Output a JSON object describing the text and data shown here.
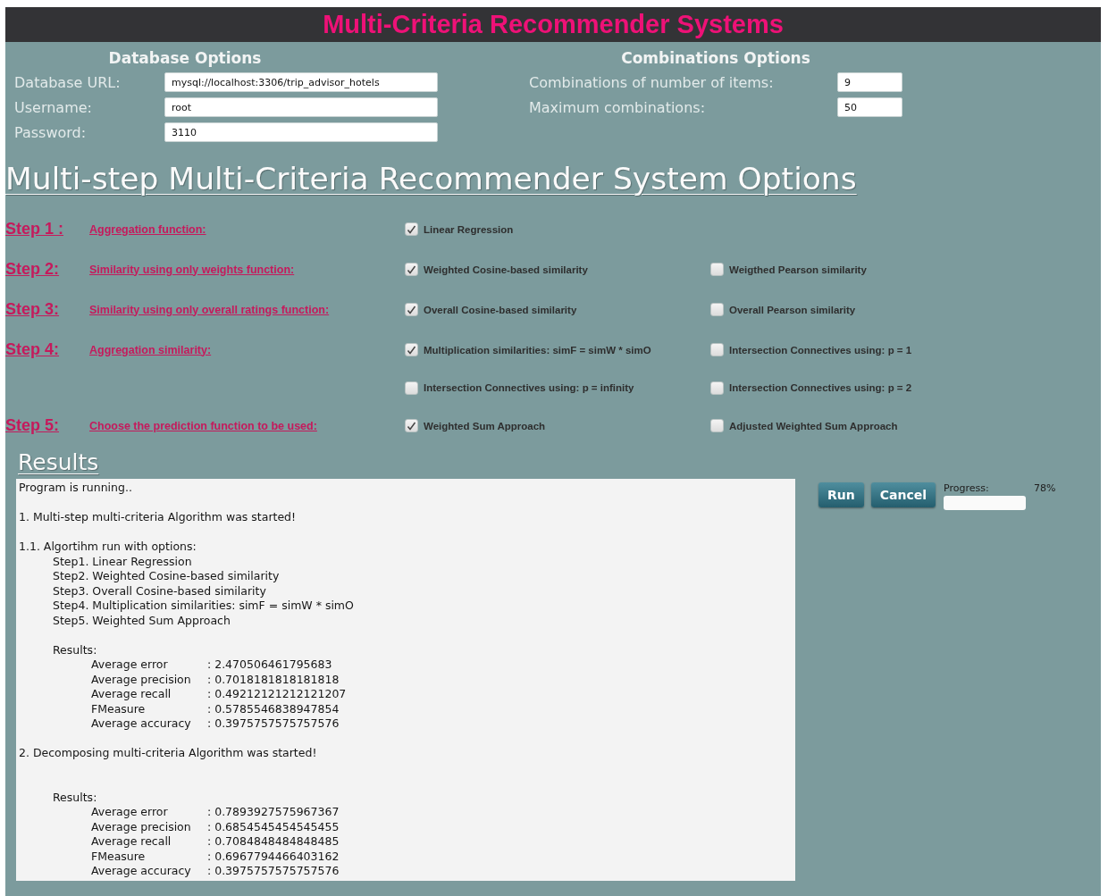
{
  "window": {
    "title": "Multi-Criteria Recommender Systems"
  },
  "database_options": {
    "title": "Database Options",
    "fields": [
      {
        "label": "Database URL:",
        "value": "mysql://localhost:3306/trip_advisor_hotels"
      },
      {
        "label": "Username:",
        "value": "root"
      },
      {
        "label": "Password:",
        "value": "3110"
      }
    ]
  },
  "combinations_options": {
    "title": "Combinations Options",
    "fields": [
      {
        "label": "Combinations of number of items:",
        "value": "9"
      },
      {
        "label": "Maximum combinations:",
        "value": "50"
      }
    ]
  },
  "options_heading": "Multi-step Multi-Criteria Recommender System Options",
  "steps": [
    {
      "step": "Step 1 :",
      "label": "Aggregation function:",
      "option_rows": [
        [
          {
            "label": "Linear Regression",
            "checked": true
          }
        ]
      ]
    },
    {
      "step": "Step 2:",
      "label": "Similarity using only weights function:",
      "option_rows": [
        [
          {
            "label": "Weighted Cosine-based similarity",
            "checked": true
          },
          {
            "label": "Weigthed Pearson similarity",
            "checked": false
          }
        ]
      ]
    },
    {
      "step": "Step 3:",
      "label": "Similarity using only overall ratings function:",
      "option_rows": [
        [
          {
            "label": "Overall Cosine-based similarity",
            "checked": true
          },
          {
            "label": "Overall Pearson similarity",
            "checked": false
          }
        ]
      ]
    },
    {
      "step": "Step 4:",
      "label": "Aggregation similarity:",
      "option_rows": [
        [
          {
            "label": "Multiplication similarities: simF = simW * simO",
            "checked": true
          },
          {
            "label": "Intersection Connectives using: p = 1",
            "checked": false
          }
        ],
        [
          {
            "label": "Intersection Connectives using: p = infinity",
            "checked": false
          },
          {
            "label": "Intersection Connectives using: p = 2",
            "checked": false
          }
        ]
      ]
    },
    {
      "step": "Step 5:",
      "label": "Choose the prediction function to be used:",
      "option_rows": [
        [
          {
            "label": "Weighted Sum Approach",
            "checked": true
          },
          {
            "label": "Adjusted Weighted Sum Approach",
            "checked": false
          }
        ]
      ]
    }
  ],
  "results": {
    "title": "Results",
    "log": [
      {
        "text": "Program is running.."
      },
      {
        "text": "1. Multi-step multi-criteria Algorithm was started!"
      },
      {
        "text": "1.1. Algortihm run with options:",
        "children": [
          {
            "text": "Step1. Linear Regression"
          },
          {
            "text": "Step2. Weighted Cosine-based similarity"
          },
          {
            "text": "Step3. Overall Cosine-based similarity"
          },
          {
            "text": "Step4. Multiplication similarities: simF = simW * simO"
          },
          {
            "text": "Step5. Weighted Sum Approach"
          },
          {
            "text": "Results:",
            "metrics": [
              {
                "label": "Average error",
                "value": ": 2.470506461795683"
              },
              {
                "label": "Average precision",
                "value": ": 0.7018181818181818"
              },
              {
                "label": "Average recall",
                "value": ": 0.49212121212121207"
              },
              {
                "label": "FMeasure",
                "value": ": 0.5785546838947854"
              },
              {
                "label": "Average accuracy",
                "value": ": 0.3975757575757576"
              }
            ]
          }
        ]
      },
      {
        "text": "2. Decomposing multi-criteria Algorithm was started!",
        "children": [
          {
            "text": "Results:",
            "metrics": [
              {
                "label": "Average error",
                "value": ": 0.7893927575967367"
              },
              {
                "label": "Average precision",
                "value": ": 0.6854545454545455"
              },
              {
                "label": "Average recall",
                "value": ": 0.7084848484848485"
              },
              {
                "label": "FMeasure",
                "value": ": 0.6967794466403162"
              },
              {
                "label": "Average accuracy",
                "value": ": 0.3975757575757576"
              }
            ]
          }
        ]
      }
    ]
  },
  "buttons": [
    "Run",
    "Cancel"
  ],
  "progress": {
    "label": "Progress:",
    "reading": "78%",
    "level": 0
  }
}
